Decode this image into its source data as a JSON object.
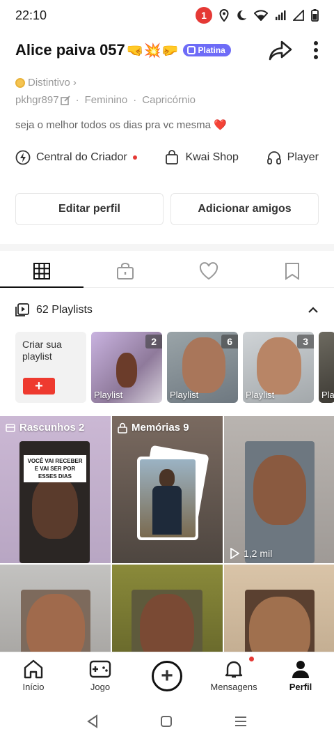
{
  "status_bar": {
    "time": "22:10",
    "notification_count": "1"
  },
  "profile": {
    "name": "Alice paiva 057",
    "name_emojis": "🤜💥🤛",
    "badge_label": "Platina",
    "distintivo": "Distintivo",
    "handle": "pkhgr897",
    "gender": "Feminino",
    "sign": "Capricórnio",
    "bio": "seja o melhor todos os dias pra vc mesma ❤️"
  },
  "quick_links": [
    {
      "label": "Central do Criador",
      "icon": "bolt-icon"
    },
    {
      "label": "Kwai Shop",
      "icon": "bag-icon"
    },
    {
      "label": "Player",
      "icon": "headphones-icon"
    }
  ],
  "buttons": {
    "edit_profile": "Editar perfil",
    "add_friends": "Adicionar amigos"
  },
  "tabs": [
    "grid-icon",
    "lock-icon",
    "heart-icon",
    "bookmark-icon"
  ],
  "playlists": {
    "header": "62 Playlists",
    "create_label": "Criar sua playlist",
    "create_plus": "+",
    "items": [
      {
        "count": "2",
        "label": "Playlist"
      },
      {
        "count": "6",
        "label": "Playlist"
      },
      {
        "count": "3",
        "label": "Playlist"
      },
      {
        "count": "",
        "label": "Pla"
      }
    ]
  },
  "grid": {
    "drafts": "Rascunhos 2",
    "drafts_caption": "VOCÊ VAI RECEBER E VAI SER POR ESSES DIAS",
    "memories": "Memórias 9",
    "views": "1,2 mil"
  },
  "bottom_nav": {
    "home": "Início",
    "game": "Jogo",
    "create": "+",
    "messages": "Mensagens",
    "profile": "Perfil"
  },
  "colors": {
    "accent": "#ee3a2f",
    "platina": "#6e6cf7",
    "notification": "#e53935"
  }
}
